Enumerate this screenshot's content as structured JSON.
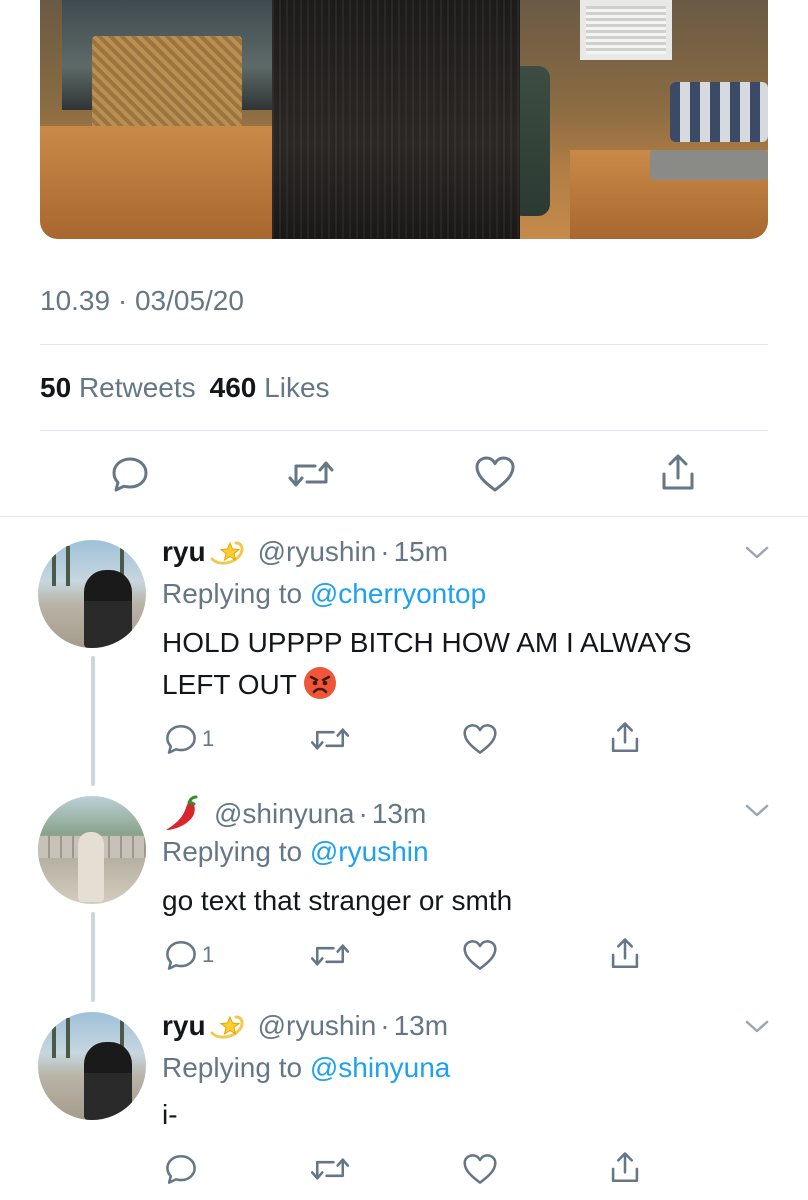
{
  "tweet": {
    "timestamp": "10.39 · 03/05/20",
    "retweets_count": "50",
    "retweets_label": "Retweets",
    "likes_count": "460",
    "likes_label": "Likes"
  },
  "replies": [
    {
      "name": "ryu",
      "handle": "@ryushin",
      "dot": "·",
      "time": "15m",
      "replying_prefix": "Replying to",
      "replying_to": "@cherryontop",
      "text_line1": "HOLD UPPPP BITCH HOW AM I ALWAYS",
      "text_line2": "LEFT OUT",
      "reply_count": "1",
      "name_emoji": "dizzy-star-emoji",
      "text_emoji": "angry-face-emoji"
    },
    {
      "name": "",
      "handle": "@shinyuna",
      "dot": "·",
      "time": "13m",
      "replying_prefix": "Replying to",
      "replying_to": "@ryushin",
      "text_line1": "go text that stranger or smth",
      "reply_count": "1",
      "name_emoji": "chili-pepper-emoji"
    },
    {
      "name": "ryu",
      "handle": "@ryushin",
      "dot": "·",
      "time": "13m",
      "replying_prefix": "Replying to",
      "replying_to": "@shinyuna",
      "text_line1": "i-",
      "name_emoji": "dizzy-star-emoji"
    }
  ],
  "colors": {
    "accent": "#1da1f2",
    "secondary_text": "#657786",
    "divider": "#e1e8ed",
    "thread_line": "#ccd6dd"
  }
}
